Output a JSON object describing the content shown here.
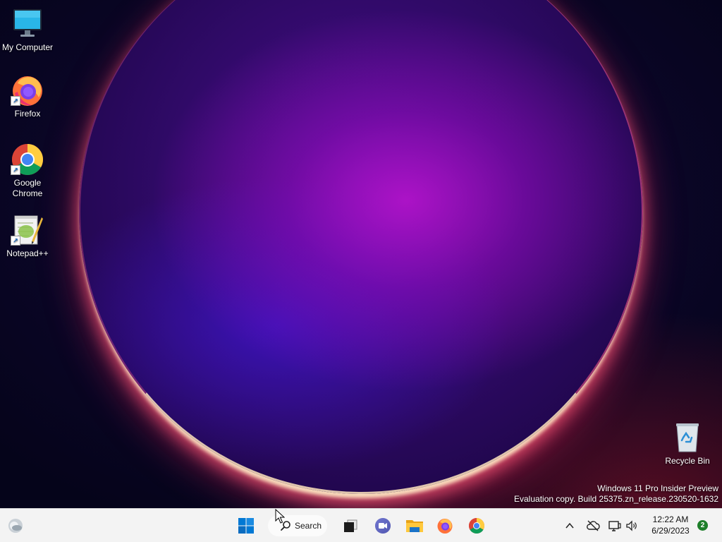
{
  "desktop": {
    "icons": [
      {
        "label": "My Computer",
        "icon": "monitor-icon"
      },
      {
        "label": "Firefox",
        "icon": "firefox-icon"
      },
      {
        "label": "Google Chrome",
        "icon": "chrome-icon"
      },
      {
        "label": "Notepad++",
        "icon": "notepadpp-icon"
      },
      {
        "label": "Recycle Bin",
        "icon": "recycle-bin-icon"
      }
    ],
    "watermark": {
      "line1": "Windows 11 Pro Insider Preview",
      "line2": "Evaluation copy. Build 25375.zn_release.230520-1632"
    }
  },
  "taskbar": {
    "widgets_icon": "weather-widget-icon",
    "start_icon": "windows-start-icon",
    "search_label": "Search",
    "pinned": [
      "task-view-icon",
      "teams-chat-icon",
      "file-explorer-icon",
      "firefox-icon",
      "chrome-icon"
    ],
    "tray": {
      "chevron": "chevron-up-icon",
      "network": "cloud-offline-icon",
      "display": "display-network-icon",
      "volume": "speaker-icon"
    },
    "clock": {
      "time": "12:22 AM",
      "date": "6/29/2023"
    },
    "notification_count": "2"
  },
  "colors": {
    "taskbar_bg": "#f3f3f3",
    "accent_start": "#0078d4",
    "badge": "#1e7f2a"
  }
}
